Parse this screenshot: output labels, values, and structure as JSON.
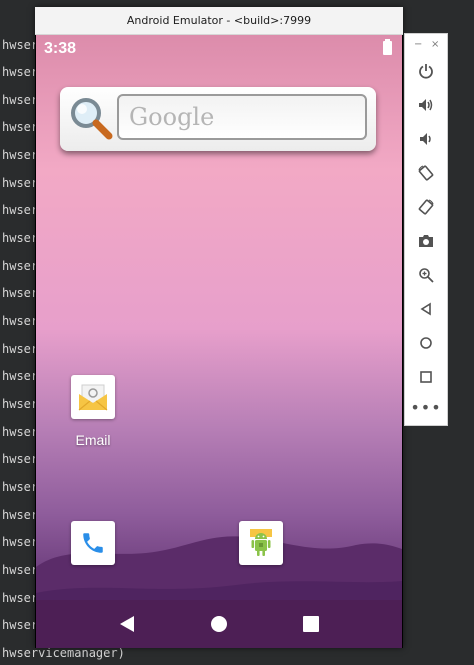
{
  "terminal": {
    "lines": [
      "hwser",
      "hwser",
      "hwser",
      "hwser",
      "hwser",
      "hwser",
      "hwser",
      "hwser",
      "hwser",
      "hwser",
      "hwser",
      "hwser",
      "hwser",
      "hwser",
      "hwser",
      "hwser",
      "hwser",
      "hwser",
      "hwser",
      "hwser",
      "hwser",
      "hwser"
    ],
    "last_line": "hwservicemanager)"
  },
  "window": {
    "title": "Android Emulator - <build>:7999"
  },
  "status_bar": {
    "time": "3:38",
    "battery_icon": "battery-full-icon"
  },
  "search_widget": {
    "placeholder": "Google",
    "icon": "magnifier-icon"
  },
  "apps": {
    "email_label": "Email",
    "email_icon": "envelope-icon",
    "phone_icon": "phone-icon",
    "android_icon": "android-robot-icon"
  },
  "nav": {
    "back_icon": "back-triangle-icon",
    "home_icon": "home-circle-icon",
    "recents_icon": "recents-square-icon"
  },
  "toolbar": {
    "minimize": "−",
    "close": "×",
    "more": "•••",
    "items": [
      "power-icon",
      "volume-up-icon",
      "volume-down-icon",
      "rotate-left-icon",
      "rotate-right-icon",
      "camera-icon",
      "zoom-icon",
      "back-icon",
      "home-icon",
      "overview-icon",
      "more-icon"
    ]
  },
  "colors": {
    "nav_bar": "#4d1f55",
    "phone_blue": "#2a8ee8",
    "android_green": "#8bc34a",
    "email_yellow": "#f6c544"
  }
}
